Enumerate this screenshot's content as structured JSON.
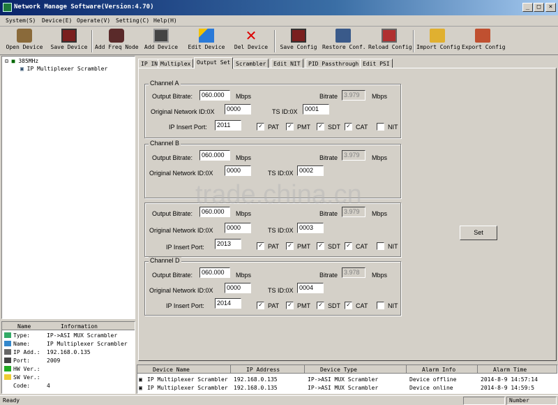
{
  "window": {
    "title": "Network Manage Software(Version:4.70)"
  },
  "menu": [
    "System(S)",
    "Device(E)",
    "Operate(V)",
    "Setting(C)",
    "Help(H)"
  ],
  "toolbar": [
    "Open Device",
    "Save Device",
    "Add Freq Node",
    "Add Device",
    "Edit Device",
    "Del Device",
    "Save Config",
    "Restore Conf.",
    "Reload Config",
    "Import Config",
    "Export Config"
  ],
  "tree": {
    "root": "385MHz",
    "child": "IP Multiplexer Scrambler"
  },
  "info": {
    "col_name": "Name",
    "col_info": "Information",
    "rows": [
      {
        "k": "Type:",
        "v": "IP->ASI MUX Scrambler"
      },
      {
        "k": "Name:",
        "v": "IP Multiplexer Scrambler"
      },
      {
        "k": "IP Add.:",
        "v": "192.168.0.135"
      },
      {
        "k": "Port:",
        "v": "2009"
      },
      {
        "k": "HW Ver.:",
        "v": ""
      },
      {
        "k": "SW Ver.:",
        "v": ""
      },
      {
        "k": "Code:",
        "v": "4"
      }
    ]
  },
  "tabs": [
    "IP IN",
    "Multiplex",
    "Output Set",
    "Scrambler",
    "Edit NIT",
    "PID Passthrough",
    "Edit PSI"
  ],
  "labels": {
    "output_bitrate": "Output Bitrate:",
    "mbps": "Mbps",
    "bitrate": "Bitrate",
    "onid": "Original Network ID:0X",
    "tsid": "TS ID:0X",
    "ip_port": "IP Insert Port:",
    "set": "Set",
    "pat": "PAT",
    "pmt": "PMT",
    "sdt": "SDT",
    "cat": "CAT",
    "nit": "NIT"
  },
  "channels": [
    {
      "name": "Channel A",
      "out": "060.000",
      "bitrate": "3.979",
      "onid": "0000",
      "tsid": "0001",
      "port": "2011"
    },
    {
      "name": "Channel B",
      "out": "060.000",
      "bitrate": "3.979",
      "onid": "0000",
      "tsid": "0002",
      "port": ""
    },
    {
      "name": "",
      "out": "060.000",
      "bitrate": "3.979",
      "onid": "0000",
      "tsid": "0003",
      "port": "2013"
    },
    {
      "name": "Channel D",
      "out": "060.000",
      "bitrate": "3.978",
      "onid": "0000",
      "tsid": "0004",
      "port": "2014"
    }
  ],
  "watermark": "trade.china.cn",
  "devlist": {
    "headers": [
      "Device Name",
      "IP Address",
      "Device Type",
      "Alarm Info",
      "Alarm Time"
    ],
    "rows": [
      [
        "IP Multiplexer Scrambler",
        "192.168.0.135",
        "IP->ASI MUX Scrambler",
        "Device offline",
        "2014-8-9 14:57:14"
      ],
      [
        "IP Multiplexer Scrambler",
        "192.168.0.135",
        "IP->ASI MUX Scrambler",
        "Device online",
        "2014-8-9 14:59:5"
      ]
    ]
  },
  "status": {
    "left": "Ready",
    "right": "Number"
  }
}
